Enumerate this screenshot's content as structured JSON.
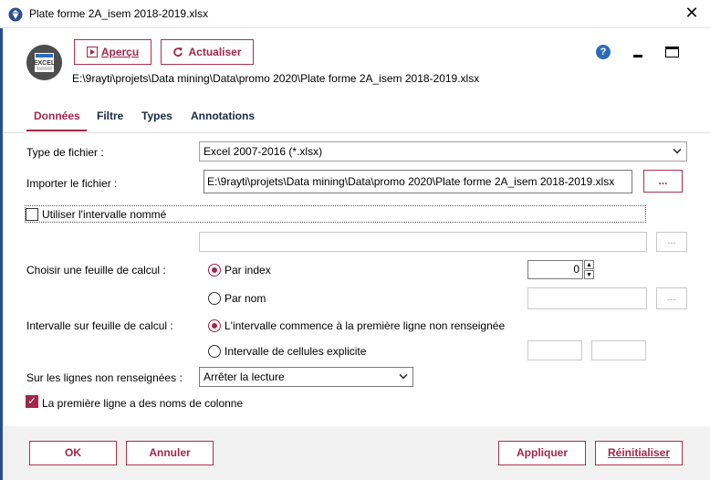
{
  "window": {
    "title": "Plate forme  2A_isem 2018-2019.xlsx",
    "close": "✕"
  },
  "header": {
    "logo_text": "EXCEL",
    "apercu_label": "Aperçu",
    "actualiser_label": "Actualiser",
    "filepath": "E:\\9rayti\\projets\\Data mining\\Data\\promo 2020\\Plate forme  2A_isem 2018-2019.xlsx",
    "help": "?"
  },
  "tabs": [
    {
      "label": "Données",
      "active": true
    },
    {
      "label": "Filtre",
      "active": false
    },
    {
      "label": "Types",
      "active": false
    },
    {
      "label": "Annotations",
      "active": false
    }
  ],
  "form": {
    "type_label": "Type de fichier :",
    "type_value": "Excel 2007-2016 (*.xlsx)",
    "import_label": "Importer le fichier :",
    "import_value": "E:\\9rayti\\projets\\Data mining\\Data\\promo 2020\\Plate forme  2A_isem 2018-2019.xlsx",
    "browse": "...",
    "named_range_label": "Utiliser l'intervalle nommé",
    "named_range_checked": false,
    "sheet_label": "Choisir une feuille de calcul :",
    "by_index_label": "Par index",
    "by_index_value": "0",
    "by_name_label": "Par nom",
    "range_label": "Intervalle sur feuille de calcul :",
    "first_row_label": "L'intervalle commence à la première ligne non renseignée",
    "explicit_label": "Intervalle de cellules explicite",
    "empty_rows_label": "Sur les lignes non renseignées :",
    "empty_rows_value": "Arrêter la lecture",
    "header_row_label": "La première ligne a des noms de colonne",
    "header_row_checked": true
  },
  "footer": {
    "ok": "OK",
    "annuler": "Annuler",
    "appliquer": "Appliquer",
    "reinitialiser": "Réinitialiser"
  },
  "colors": {
    "accent": "#a0284a",
    "navy": "#1a2a45",
    "help_blue": "#2f6cb6"
  }
}
